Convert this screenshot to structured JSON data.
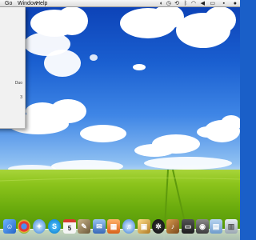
{
  "menubar": {
    "items": [
      "Go",
      "Window",
      "Help"
    ]
  },
  "about_window": {
    "lines": [
      "Duo",
      "",
      "3"
    ]
  },
  "dock": {
    "calendar_day": "5",
    "icons": [
      "finder-icon",
      "chrome-icon",
      "safari-icon",
      "skype-icon",
      "calendar-icon",
      "preview-icon",
      "mail-icon",
      "ical-icon",
      "itunes-icon",
      "photo-icon",
      "dashboard-icon",
      "guitar-icon",
      "terminal-icon",
      "camera-icon",
      "folder-icon",
      "trash-icon"
    ]
  }
}
